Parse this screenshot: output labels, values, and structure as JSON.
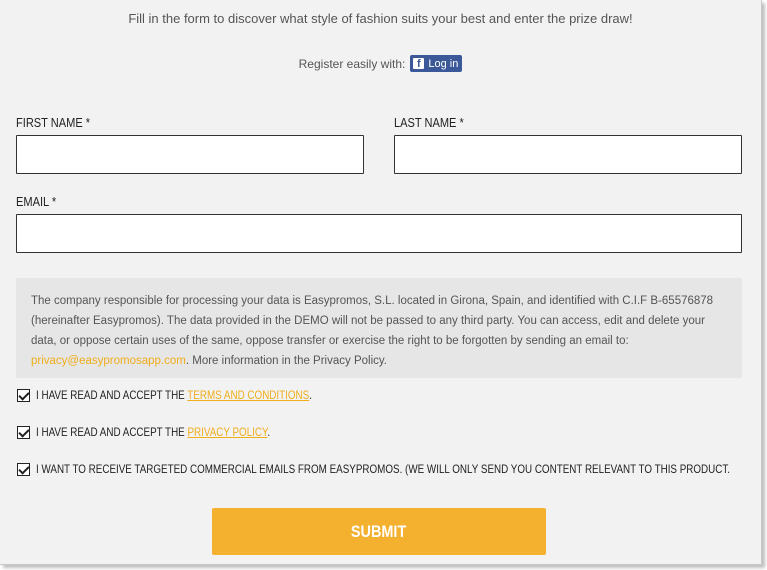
{
  "intro": "Fill in the form to discover what style of fashion suits your best and enter the prize draw!",
  "register": {
    "label": "Register easily with:",
    "facebook_icon": "f",
    "facebook_button": "Log in"
  },
  "fields": {
    "first_name": {
      "label": "FIRST NAME *",
      "value": "",
      "placeholder": ""
    },
    "last_name": {
      "label": "LAST NAME *",
      "value": "",
      "placeholder": ""
    },
    "email": {
      "label": "EMAIL *",
      "value": "",
      "placeholder": ""
    }
  },
  "privacy": {
    "text": "The company responsible for processing your data is Easypromos, S.L. located in Girona, Spain, and identified with C.I.F B-65576878 (hereinafter Easypromos). The data provided in the DEMO will not be passed to any third party. You can access, edit and delete your data, or oppose certain uses of the same, oppose transfer or exercise the right to be forgotten by sending an email to:",
    "email_link": "privacy@easypromosapp.com",
    "more_info": ". More information in the Privacy Policy."
  },
  "checkboxes": [
    {
      "prefix": "I HAVE READ AND ACCEPT THE ",
      "link": "TERMS AND CONDITIONS",
      "suffix": ".",
      "checked": true
    },
    {
      "prefix": "I HAVE READ AND ACCEPT THE ",
      "link": "PRIVACY POLICY",
      "suffix": ".",
      "checked": true
    },
    {
      "prefix": "I WANT TO RECEIVE TARGETED COMMERCIAL EMAILS FROM EASYPROMOS. (WE WILL ONLY SEND YOU CONTENT RELEVANT TO THIS PRODUCT.",
      "link": "",
      "suffix": "",
      "checked": true
    }
  ],
  "submit_label": "SUBMIT",
  "colors": {
    "accent": "#f4b02f",
    "link": "#f0ad1c",
    "facebook": "#3b5998",
    "background": "#f2f2f2"
  }
}
